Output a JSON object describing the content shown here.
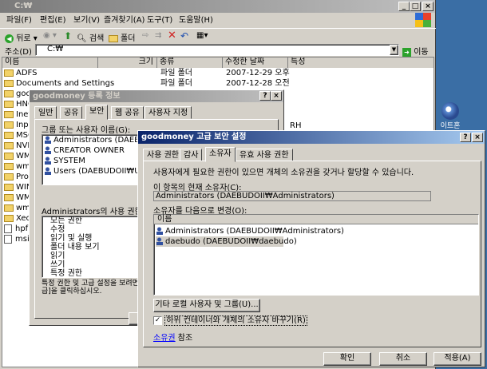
{
  "explorer": {
    "title": "C:₩",
    "menu": [
      "파일(F)",
      "편집(E)",
      "보기(V)",
      "즐겨찾기(A)",
      "도구(T)",
      "도움말(H)"
    ],
    "toolbar": {
      "back": "뒤로",
      "search": "검색",
      "folders": "폴더"
    },
    "address_label": "주소(D)",
    "address_value": "C:₩",
    "go_label": "이동",
    "columns": [
      "이름",
      "크기",
      "종류",
      "수정한 날짜",
      "특성"
    ],
    "files": [
      {
        "name": "ADFS",
        "type": "파일 폴더",
        "date": "2007-12-29 오후"
      },
      {
        "name": "Documents and Settings",
        "type": "파일 폴더",
        "date": "2007-12-28 오전"
      },
      {
        "name": "goodmoney",
        "type": "",
        "date": ""
      },
      {
        "name": "HNC",
        "type": "",
        "date": ""
      },
      {
        "name": "Inetp",
        "type": "",
        "date": ""
      },
      {
        "name": "Inpri",
        "type": "",
        "date": ""
      },
      {
        "name": "MSC",
        "type": "",
        "date": ""
      },
      {
        "name": "NVID",
        "type": "",
        "date": ""
      },
      {
        "name": "WMP",
        "type": "",
        "date": ""
      },
      {
        "name": "wmp",
        "type": "",
        "date": ""
      },
      {
        "name": "Progr",
        "type": "",
        "date": ""
      },
      {
        "name": "WIND",
        "type": "",
        "date": ""
      },
      {
        "name": "WMF",
        "type": "",
        "date": ""
      },
      {
        "name": "wmpr",
        "type": "",
        "date": ""
      },
      {
        "name": "Xecu",
        "type": "",
        "date": ""
      },
      {
        "name": "hpfr5",
        "type": "",
        "date": ""
      },
      {
        "name": "msiz",
        "type": "",
        "date": ""
      }
    ],
    "attr_value": "RH"
  },
  "desktop_icon_label": "이트혼",
  "props": {
    "title": "goodmoney 등록 정보",
    "tabs": [
      "일반",
      "공유",
      "보안",
      "웹 공유",
      "사용자 지정"
    ],
    "group_label": "그룹 또는 사용자 이름(G):",
    "users": [
      "Administrators (DAEBUDO",
      "CREATOR OWNER",
      "SYSTEM",
      "Users (DAEBUDOII₩Users"
    ],
    "perm_label": "Administrators의 사용 권한(P)",
    "perms": [
      "모든 권한",
      "수정",
      "읽기 및 실행",
      "폴더 내용 보기",
      "읽기",
      "쓰기",
      "특정 권한"
    ],
    "note": "특정 권한 및 고급 설정을 보려면 [고급]을 클릭하십시오."
  },
  "advanced": {
    "title": "goodmoney 고급 보안 설정",
    "tabs": [
      "사용 권한",
      "감사",
      "소유자",
      "유효 사용 권한"
    ],
    "description": "사용자에게 필요한 권한이 있으면 개체의 소유권을 갖거나 할당할 수 있습니다.",
    "current_owner_label": "이 항목의 현재 소유자(C):",
    "current_owner": "Administrators (DAEBUDOII₩Administrators)",
    "change_label": "소유자를 다음으로 변경(O):",
    "list_header": "이름",
    "owners": [
      "Administrators (DAEBUDOII₩Administrators)",
      "daebudo (DAEBUDOII₩daebudo)"
    ],
    "other_users_btn": "기타 로컬 사용자 및 그룹(U)...",
    "replace_checkbox": "하위 컨테이너와 개체의 소유자 바꾸기(R)",
    "replace_checked": true,
    "help_link": "소유권",
    "help_suffix": "참조",
    "ok": "확인",
    "cancel": "취소",
    "apply": "적용(A)"
  }
}
